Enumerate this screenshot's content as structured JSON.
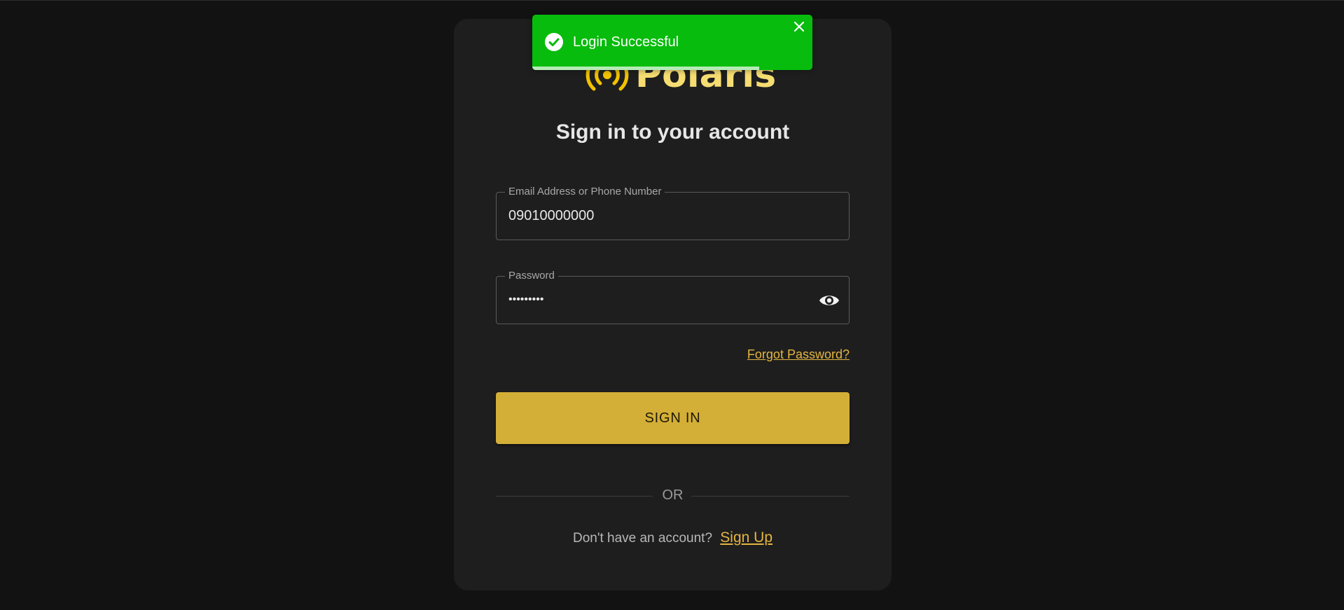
{
  "brand": {
    "name": "Polaris",
    "logo_icon": "broadcast-icon",
    "color": "#f5dd72",
    "icon_color": "#f2c200"
  },
  "page": {
    "heading": "Sign in to your account"
  },
  "form": {
    "email": {
      "label": "Email Address or Phone Number",
      "value": "09010000000"
    },
    "password": {
      "label": "Password",
      "value": "•••••••••",
      "toggle_icon": "eye-icon"
    },
    "forgot_label": "Forgot Password?",
    "submit_label": "SIGN IN",
    "divider_text": "OR",
    "signup_prompt": "Don't have an account?",
    "signup_label": "Sign Up"
  },
  "toast": {
    "message": "Login Successful",
    "status": "success",
    "icon": "check-circle-icon",
    "close_icon": "close-icon",
    "color": "#07bc0c",
    "progress": 0.81
  },
  "colors": {
    "background": "#121212",
    "card": "#1e1e1e",
    "accent": "#d4af37",
    "link": "#e3b541"
  }
}
